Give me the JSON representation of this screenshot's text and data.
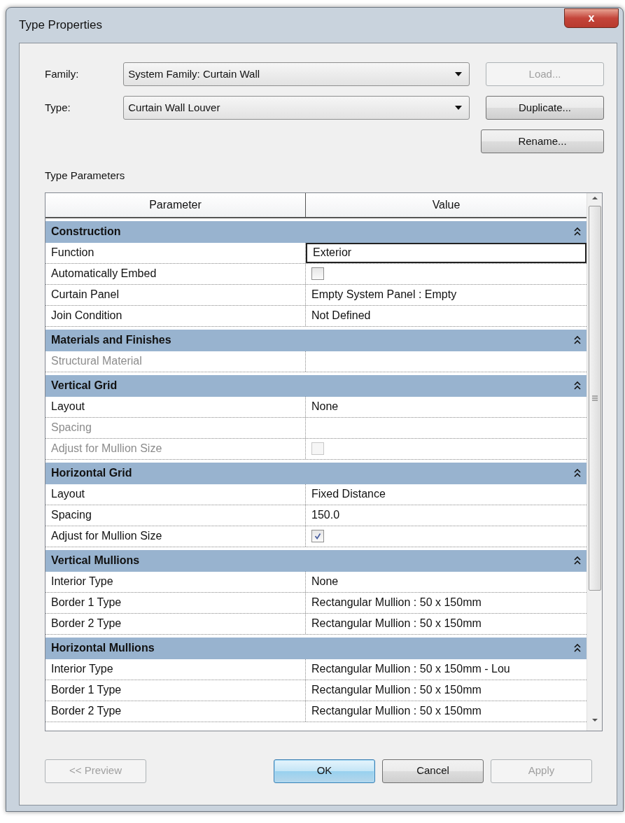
{
  "window": {
    "title": "Type Properties",
    "close_label": "x"
  },
  "fields": [
    {
      "label": "Family:",
      "value": "System Family: Curtain Wall",
      "button": {
        "label": "Load...",
        "disabled": true
      }
    },
    {
      "label": "Type:",
      "value": "Curtain Wall Louver",
      "button": {
        "label": "Duplicate...",
        "disabled": false
      }
    }
  ],
  "rename_button": {
    "label": "Rename...",
    "disabled": false
  },
  "section_label": "Type Parameters",
  "table": {
    "columns": [
      "Parameter",
      "Value"
    ],
    "groups": [
      {
        "title": "Construction",
        "expanded": true,
        "rows": [
          {
            "name": "Function",
            "kind": "text",
            "value": "Exterior",
            "disabled": false,
            "selected": true
          },
          {
            "name": "Automatically Embed",
            "kind": "checkbox",
            "checked": false,
            "disabled": false,
            "selected": false
          },
          {
            "name": "Curtain Panel",
            "kind": "text",
            "value": "Empty System Panel : Empty",
            "disabled": false,
            "selected": false
          },
          {
            "name": "Join Condition",
            "kind": "text",
            "value": "Not Defined",
            "disabled": false,
            "selected": false
          }
        ]
      },
      {
        "title": "Materials and Finishes",
        "expanded": true,
        "rows": [
          {
            "name": "Structural Material",
            "kind": "empty",
            "disabled": true,
            "selected": false
          }
        ]
      },
      {
        "title": "Vertical Grid",
        "expanded": true,
        "rows": [
          {
            "name": "Layout",
            "kind": "text",
            "value": "None",
            "disabled": false,
            "selected": false
          },
          {
            "name": "Spacing",
            "kind": "empty",
            "disabled": true,
            "selected": false
          },
          {
            "name": "Adjust for Mullion Size",
            "kind": "checkbox",
            "checked": false,
            "disabled": true,
            "selected": false
          }
        ]
      },
      {
        "title": "Horizontal Grid",
        "expanded": true,
        "rows": [
          {
            "name": "Layout",
            "kind": "text",
            "value": "Fixed Distance",
            "disabled": false,
            "selected": false
          },
          {
            "name": "Spacing",
            "kind": "text",
            "value": "150.0",
            "disabled": false,
            "selected": false
          },
          {
            "name": "Adjust for Mullion Size",
            "kind": "checkbox",
            "checked": true,
            "disabled": false,
            "selected": false
          }
        ]
      },
      {
        "title": "Vertical Mullions",
        "expanded": true,
        "rows": [
          {
            "name": "Interior Type",
            "kind": "text",
            "value": "None",
            "disabled": false,
            "selected": false
          },
          {
            "name": "Border 1 Type",
            "kind": "text",
            "value": "Rectangular Mullion : 50 x 150mm",
            "disabled": false,
            "selected": false
          },
          {
            "name": "Border 2 Type",
            "kind": "text",
            "value": "Rectangular Mullion : 50 x 150mm",
            "disabled": false,
            "selected": false
          }
        ]
      },
      {
        "title": "Horizontal Mullions",
        "expanded": true,
        "rows": [
          {
            "name": "Interior Type",
            "kind": "text",
            "value": "Rectangular Mullion : 50 x 150mm - Lou",
            "disabled": false,
            "selected": false
          },
          {
            "name": "Border 1 Type",
            "kind": "text",
            "value": "Rectangular Mullion : 50 x 150mm",
            "disabled": false,
            "selected": false
          },
          {
            "name": "Border 2 Type",
            "kind": "text",
            "value": "Rectangular Mullion : 50 x 150mm",
            "disabled": false,
            "selected": false
          }
        ]
      }
    ]
  },
  "footer_buttons": [
    {
      "label": "<< Preview",
      "disabled": true,
      "default": false
    },
    {
      "label": "OK",
      "disabled": false,
      "default": true
    },
    {
      "label": "Cancel",
      "disabled": false,
      "default": false
    },
    {
      "label": "Apply",
      "disabled": true,
      "default": false
    }
  ]
}
